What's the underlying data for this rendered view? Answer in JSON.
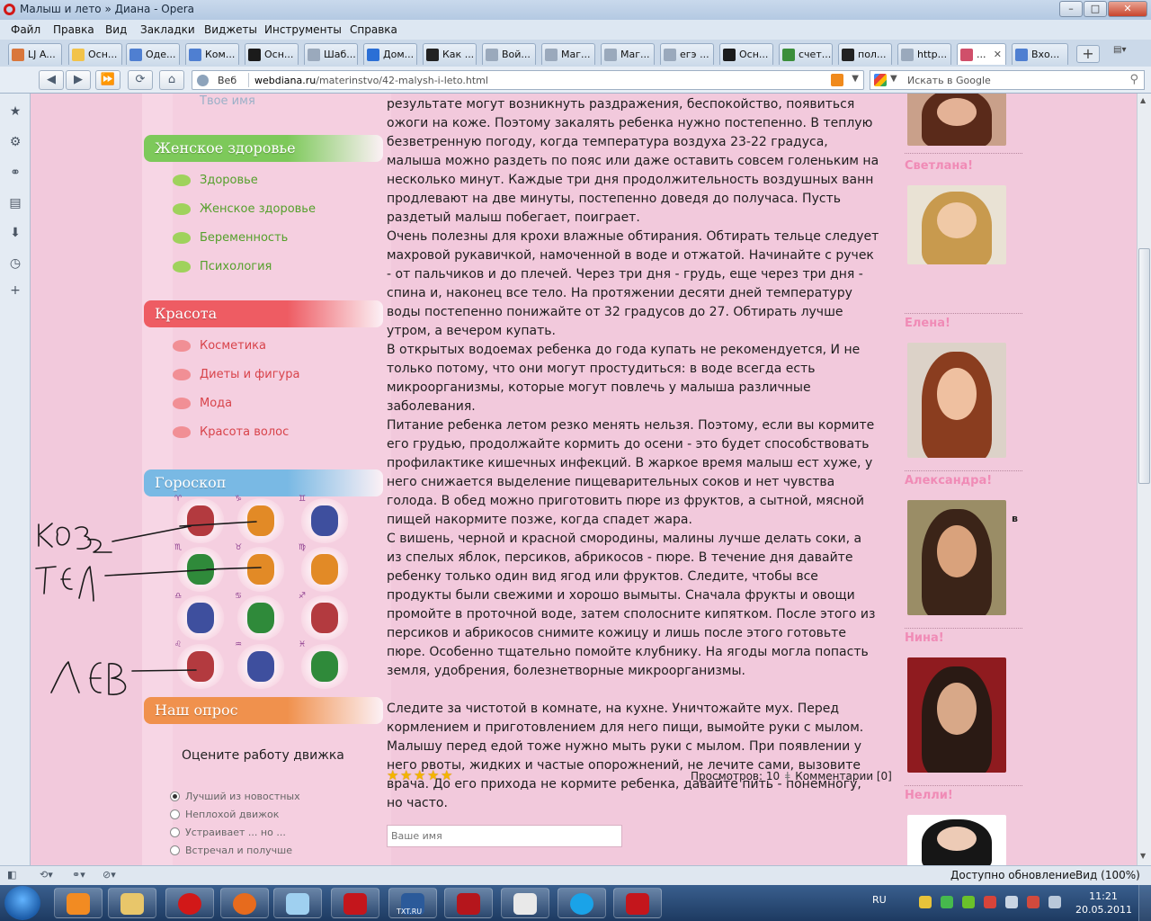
{
  "window": {
    "title": "Малыш и лето » Диана - Opera",
    "controls": [
      "–",
      "□",
      "✕"
    ]
  },
  "menu": [
    "Файл",
    "Правка",
    "Вид",
    "Закладки",
    "Виджеты",
    "Инструменты",
    "Справка"
  ],
  "tabs": [
    {
      "label": "LJ A...",
      "color": "#d9773c"
    },
    {
      "label": "Осн...",
      "color": "#f2c34a"
    },
    {
      "label": "Оде...",
      "color": "#4f7fd1"
    },
    {
      "label": "Ком...",
      "color": "#4f7fd1"
    },
    {
      "label": "Осн...",
      "color": "#1b1b1b"
    },
    {
      "label": "Шаб...",
      "color": "#9aa9bc"
    },
    {
      "label": "Дом...",
      "color": "#2b6fd6"
    },
    {
      "label": "Как ...",
      "color": "#222222"
    },
    {
      "label": "Вой...",
      "color": "#9aa9bc"
    },
    {
      "label": "Маг...",
      "color": "#9aa9bc"
    },
    {
      "label": "Маг...",
      "color": "#9aa9bc"
    },
    {
      "label": "егэ ...",
      "color": "#9aa9bc"
    },
    {
      "label": "Осн...",
      "color": "#1b1b1b"
    },
    {
      "label": "счет...",
      "color": "#3b8e3b"
    },
    {
      "label": "пол...",
      "color": "#222222"
    },
    {
      "label": "http...",
      "color": "#9aa9bc"
    },
    {
      "label": "...",
      "color": "#d04f6a"
    },
    {
      "label": "Вхо...",
      "color": "#4f7fd1"
    }
  ],
  "address": {
    "site_label": "Веб",
    "url_domain": "webdiana.ru",
    "url_path": "/materinstvo/42-malysh-i-leto.html",
    "search_placeholder": "Искать в Google"
  },
  "sidebar": {
    "name_placeholder_top": "Твое имя",
    "sections": [
      {
        "title": "Женское здоровье",
        "color": "#7dc95a",
        "links": [
          "Здоровье",
          "Женское здоровье",
          "Беременность",
          "Психология"
        ]
      },
      {
        "title": "Красота",
        "color": "#ee5c63",
        "links": [
          "Косметика",
          "Диеты и фигура",
          "Мода",
          "Красота волос"
        ]
      },
      {
        "title": "Гороскоп",
        "color": "#79b9e4",
        "links": []
      },
      {
        "title": "Наш опрос",
        "color": "#f0914d",
        "links": []
      }
    ],
    "zodiac": [
      {
        "sign": "aries",
        "mini": "♈",
        "color": "#b33a3f"
      },
      {
        "sign": "capricorn",
        "mini": "♑",
        "color": "#e28a26"
      },
      {
        "sign": "gemini",
        "mini": "♊",
        "color": "#3e4f9e"
      },
      {
        "sign": "scorpio",
        "mini": "♏",
        "color": "#2f8a3a"
      },
      {
        "sign": "taurus",
        "mini": "♉",
        "color": "#e28a26"
      },
      {
        "sign": "virgo",
        "mini": "♍",
        "color": "#e28a26"
      },
      {
        "sign": "libra",
        "mini": "♎",
        "color": "#3e4f9e"
      },
      {
        "sign": "cancer",
        "mini": "♋",
        "color": "#2f8a3a"
      },
      {
        "sign": "sagittarius",
        "mini": "♐",
        "color": "#b33a3f"
      },
      {
        "sign": "leo",
        "mini": "♌",
        "color": "#b33a3f"
      },
      {
        "sign": "aquarius",
        "mini": "♒",
        "color": "#3e4f9e"
      },
      {
        "sign": "pisces",
        "mini": "♓",
        "color": "#2f8a3a"
      }
    ],
    "poll": {
      "question": "Оцените работу движка",
      "options": [
        "Лучший из новостных",
        "Неплохой движок",
        "Устраивает ... но ...",
        "Встречал и получше"
      ],
      "selected_index": 0
    }
  },
  "article": {
    "paragraphs": [
      "результате могут возникнуть раздражения, беспокойство, появиться ожоги на коже. Поэтому закалять ребенка нужно постепенно. В теплую безветренную погоду, когда температура воздуха 23-22 градуса, малыша можно раздеть по пояс или даже оставить совсем голеньким на несколько минут. Каждые три дня продолжительность воздушных ванн продлевают на две минуты, постепенно доведя до получаса. Пусть раздетый малыш побегает, поиграет.",
      "Очень полезны для крохи влажные обтирания. Обтирать тельце следует махровой рукавичкой, намоченной в воде и отжатой. Начинайте с ручек - от пальчиков и до плечей. Через три дня - грудь, еще через три дня - спина и, наконец все тело. На протяжении десяти дней температуру воды постепенно понижайте от 32 градусов до 27. Обтирать лучше утром, а вечером купать.",
      "В открытых водоемах ребенка до года купать не рекомендуется, И не только потому, что они могут простудиться: в воде всегда есть микроорганизмы, которые могут повлечь у малыша различные заболевания.",
      "Питание ребенка летом резко менять нельзя. Поэтому, если вы кормите его грудью, продолжайте кормить до осени - это будет способствовать профилактике кишечных инфекций. В жаркое время малыш ест хуже, у него снижается выделение пищеварительных соков и нет чувства голода. В обед можно приготовить пюре из фруктов, а сытной, мясной пищей накормите позже, когда спадет жара.",
      "С вишень, черной и красной смородины, малины лучше делать соки, а из спелых яблок, персиков, абрикосов - пюре. В течение дня давайте ребенку только один вид ягод или фруктов. Следите, чтобы все продукты были свежими и хорошо вымыты. Сначала фрукты и овощи промойте в проточной воде, затем сполосните кипятком. После этого из персиков и абрикосов снимите кожицу и лишь после этого готовьте пюре. Особенно тщательно помойте клубнику. На ягоды могла попасть земля, удобрения, болезнетворные микроорганизмы.",
      "Следите за чистотой в комнате, на кухне. Уничтожайте мух. Перед кормлением и приготовлением для него пищи, вымойте руки с мылом. Малышу перед едой тоже нужно мыть руки с мылом. При появлении у него рвоты, жидких и частые опорожнений, не лечите сами, вызовите врача. До его прихода не кормите ребенка, давайте пить - понемногу, но часто."
    ],
    "rating_stars": 5,
    "views_text": "Просмотров: 10",
    "comments_text": "Комментарии [0]",
    "name_placeholder": "Ваше имя"
  },
  "right_column": {
    "people": [
      {
        "name": "",
        "hair": "#5a2a1a",
        "skin": "#e4b296",
        "bg": "#c9a08a"
      },
      {
        "name": "Светлана!",
        "hair": "#c89a4e",
        "skin": "#f0c9a6",
        "bg": "#e9e2d4"
      },
      {
        "name": "Елена!",
        "hair": "#8a3d1f",
        "skin": "#efc0a0",
        "bg": "#dcd2c8"
      },
      {
        "name": "Александра!",
        "hair": "#3b2418",
        "skin": "#d9a27c",
        "bg": "#9a8d66"
      },
      {
        "name": "Нина!",
        "hair": "#2a1a14",
        "skin": "#d8a888",
        "bg": "#8f1b1f"
      },
      {
        "name": "Нелли!",
        "hair": "#161616",
        "skin": "#edcbb6",
        "bg": "#ffffff"
      }
    ],
    "extra_letter": "в"
  },
  "annotations": {
    "labels": [
      "КОЗ",
      "ТЕЛ",
      "ЛЕВ"
    ],
    "ink_color": "#1a1a1a"
  },
  "statusbar": {
    "update_text": "Доступно обновление",
    "zoom_text": "Вид (100%)"
  },
  "taskbar": {
    "apps": [
      {
        "name": "media-player",
        "color": "#f28b22"
      },
      {
        "name": "explorer",
        "color": "#e8c66a"
      },
      {
        "name": "opera",
        "color": "#d21818"
      },
      {
        "name": "firefox",
        "color": "#e76b1d"
      },
      {
        "name": "notepad",
        "color": "#9fd0f0"
      },
      {
        "name": "acrobat",
        "color": "#c4161c"
      },
      {
        "name": "txtru",
        "color": "#2b5a9a"
      },
      {
        "name": "radio",
        "color": "#b5161c"
      },
      {
        "name": "jdownloader",
        "color": "#e9e9e9"
      },
      {
        "name": "skype",
        "color": "#1aa3e8"
      },
      {
        "name": "filezilla",
        "color": "#c4161c"
      }
    ],
    "txt_label": "TXT.RU",
    "language": "RU",
    "time": "11:21",
    "date": "20.05.2011"
  }
}
